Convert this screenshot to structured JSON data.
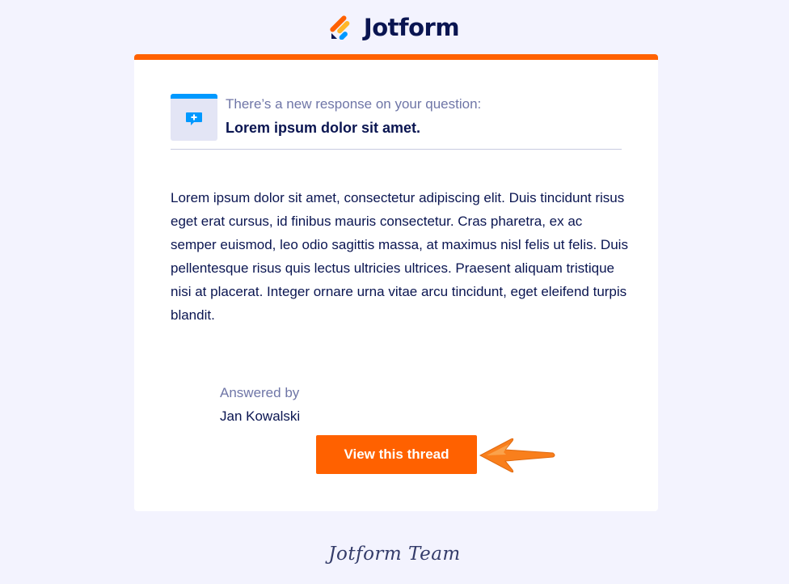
{
  "brand": {
    "name": "Jotform",
    "logo_icon": "jotform-logo-icon",
    "colors": {
      "accent": "#ff6100",
      "navy": "#0a1551",
      "blue": "#0099ff",
      "yellow": "#ffb629"
    }
  },
  "notification": {
    "icon": "question-bubble-icon",
    "subtitle": "There’s a new response on your question:",
    "question_title": "Lorem ipsum dolor sit amet."
  },
  "response": {
    "body": "Lorem ipsum dolor sit amet, consectetur adipiscing elit. Duis tincidunt risus eget erat cursus, id finibus mauris consectetur. Cras pharetra, ex ac semper euismod, leo odio sagittis massa, at maximus nisl felis ut felis. Duis pellentesque risus quis lectus ultricies ultrices. Praesent aliquam tristique nisi at placerat. Integer ornare urna vitae arcu tincidunt, eget eleifend turpis blandit.",
    "answered_by_label": "Answered by",
    "author": "Jan Kowalski"
  },
  "cta": {
    "label": "View this thread",
    "pointer_icon": "arrow-left-icon"
  },
  "footer": {
    "signature": "Jotform Team"
  }
}
